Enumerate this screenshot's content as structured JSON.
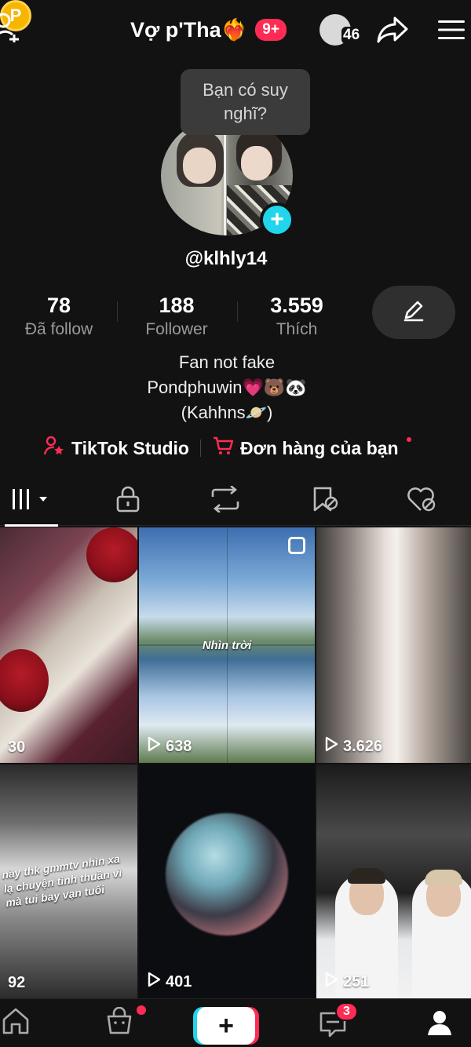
{
  "header": {
    "title": "Vợ p'Tha❤️‍🔥",
    "notification_badge": "9+",
    "friends_count": "46",
    "coin_letter": "P"
  },
  "profile": {
    "tooltip": "Bạn có suy nghĩ?",
    "username": "@klhly14",
    "stats": [
      {
        "value": "78",
        "label": "Đã follow"
      },
      {
        "value": "188",
        "label": "Follower"
      },
      {
        "value": "3.559",
        "label": "Thích"
      }
    ],
    "bio_lines": [
      "Fan not fake",
      "Pondphuwin💗🐻🐼",
      "(Kahhns🪐)"
    ],
    "links": {
      "studio": "TikTok Studio",
      "orders": "Đơn hàng của bạn"
    }
  },
  "videos": [
    {
      "views": "30"
    },
    {
      "views": "638",
      "overlay": "Nhìn trời"
    },
    {
      "views": "3.626"
    },
    {
      "views": "92",
      "overlay": "này thk gmmtv nhìn xa lạ chuyện tình thuần vì mà tui bay vạn tuổi"
    },
    {
      "views": "401"
    },
    {
      "views": "251"
    }
  ],
  "bottom_nav": {
    "create_label": "+",
    "inbox_badge": "3"
  },
  "colors": {
    "background": "#121212",
    "accent_red": "#fe2c55",
    "accent_cyan": "#20d5ec",
    "coin": "#f7b500"
  },
  "icons": [
    "add-user-icon",
    "coin-icon",
    "share-icon",
    "menu-icon",
    "pencil-icon",
    "grid-icon",
    "lock-icon",
    "repost-icon",
    "bookmark-icon",
    "liked-icon",
    "home-icon",
    "shop-icon",
    "inbox-icon",
    "profile-icon",
    "play-icon"
  ]
}
